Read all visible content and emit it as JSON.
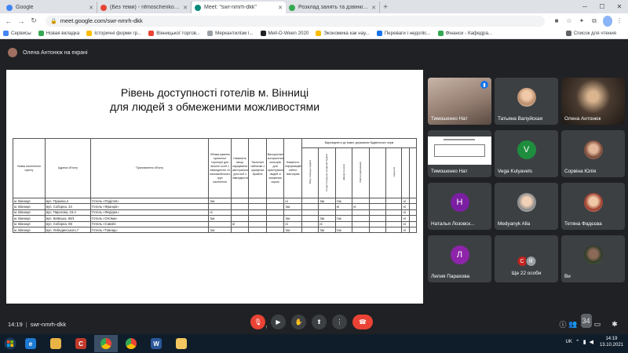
{
  "browser": {
    "tabs": [
      {
        "title": "Google",
        "color": "#4285f4",
        "active": false
      },
      {
        "title": "(Без теми) - nfmoschenkom@g",
        "color": "#ea4335",
        "active": false
      },
      {
        "title": "Meet: \"swr-nmrh-dkk\"",
        "color": "#00897b",
        "active": true
      },
      {
        "title": "Розклад занять та дзвінків | \"Ен",
        "color": "#34a853",
        "active": false
      }
    ],
    "new_tab": "+",
    "url": "meet.google.com/swr-nmrh-dkk",
    "bookmarks": [
      {
        "label": "Сервисы",
        "color": "#4285f4"
      },
      {
        "label": "Новая вкладка",
        "color": "#34a853"
      },
      {
        "label": "Історичні форми гр...",
        "color": "#fbbc05"
      },
      {
        "label": "Вінницької торгов...",
        "color": "#ea4335"
      },
      {
        "label": "Меркантилізм і...",
        "color": "#9aa0a6"
      },
      {
        "label": "Mell-O-Ween 2020",
        "color": "#202124"
      },
      {
        "label": "Экономика как нау...",
        "color": "#fbbc05"
      },
      {
        "label": "Переваги і недоліс...",
        "color": "#1a73e8"
      },
      {
        "label": "Фінанси - Кафедра...",
        "color": "#34a853"
      }
    ],
    "reading_list": "Список для чтения"
  },
  "meet": {
    "presenter": "Олена Антонюк на екрані",
    "slide": {
      "title_line1": "Рівень доступності готелів м. Вінниці",
      "title_line2": "для людей з обмеженими можливостями",
      "headers": {
        "city": "Назва населеного пункту",
        "address": "Адреса об'єкту",
        "purpose": "Призначення об'єкту",
        "col1": "Облаштування прилеглої території для вільної особ з інвалідністю та маломобільних груп населення",
        "col2": "Наявність місць паркування автотранспорту для осіб з інвалідністю",
        "col3": "Тактильні таблички з шрифтом Брайля",
        "col4": "Використання контрастних кольорів для орієнтування людей зі зниженим зором",
        "col5": "Наявність інформаційних табло/пиктограм",
        "group": "Відповідність до вимог державних будівельних норм",
        "sub1": "Вхід / вихід до будівлі",
        "sub2": "Сходи та вхід до коридорів будівлі",
        "sub3": "Дверні прорізи",
        "sub4": "Ліфти (підйомники)",
        "sub5": "санвузли"
      },
      "rows": [
        {
          "city": "м. Вінниця",
          "address": "вул. Пушкіна,4",
          "name": "Готель «Поділля»",
          "c": [
            "так",
            "",
            "",
            "",
            "ні",
            "",
            "так",
            "так",
            "",
            "",
            "",
            "ні"
          ]
        },
        {
          "city": "м. Вінниця",
          "address": "вул. Соборна, 34",
          "name": "Готель «Франція»",
          "c": [
            "",
            "",
            "",
            "",
            "так",
            "",
            "",
            "ні",
            "ні",
            "",
            "",
            "ні"
          ]
        },
        {
          "city": "м. Вінниця",
          "address": "вул. Пирогова, 23-А",
          "name": "Готель «Феріден»",
          "c": [
            "ні",
            "",
            "",
            "",
            "",
            "",
            "",
            "",
            "",
            "",
            "",
            "ні"
          ]
        },
        {
          "city": "м. Вінниця",
          "address": "вул. Київська, 50/1",
          "name": "Готель «Оптіма»",
          "c": [
            "так",
            "",
            "",
            "",
            "так",
            "",
            "так",
            "так",
            "",
            "",
            "",
            "ні"
          ]
        },
        {
          "city": "м. Вінниця",
          "address": "вул. Соборна, 69",
          "name": "Готель «Савой»",
          "c": [
            "",
            "ні",
            "",
            "",
            "ні",
            "",
            "ні",
            "",
            "",
            "",
            "",
            "ні"
          ]
        },
        {
          "city": "м. Вінниця",
          "address": "вул. Лебединського,7",
          "name": "Готель «Товнид»",
          "c": [
            "так",
            "",
            "",
            "",
            "так",
            "",
            "так",
            "так",
            "",
            "",
            "",
            "ні"
          ]
        }
      ]
    },
    "participants": [
      {
        "name": "Тимошенко Нат",
        "kind": "video",
        "speaking": true
      },
      {
        "name": "Татьяна Валуйская",
        "kind": "photo"
      },
      {
        "name": "Олена Антонюк",
        "kind": "video"
      },
      {
        "name": "Тимошенко Нат",
        "kind": "screen"
      },
      {
        "name": "Vega Kulyavets",
        "kind": "letter",
        "letter": "V",
        "color": "#1e8e3e"
      },
      {
        "name": "Сорвіна Юлія",
        "kind": "photo"
      },
      {
        "name": "Наталья Лозовск...",
        "kind": "letter",
        "letter": "Н",
        "color": "#7b1fa2"
      },
      {
        "name": "Medyanyk Alla",
        "kind": "photo"
      },
      {
        "name": "Тетяна Фадєєва",
        "kind": "photo"
      },
      {
        "name": "Лилия Парахова",
        "kind": "letter",
        "letter": "Л",
        "color": "#8e24aa"
      },
      {
        "name": "Ще 22 особи",
        "kind": "others",
        "letters": [
          "С",
          "Я"
        ]
      },
      {
        "name": "Ви",
        "kind": "photo"
      }
    ],
    "bottom": {
      "time": "14:19",
      "separator": "|",
      "meeting_code": "swr-nmrh-dkk",
      "participant_count": "34"
    }
  },
  "taskbar": {
    "lang": "UK",
    "time": "14:19",
    "date": "13.10.2021"
  }
}
